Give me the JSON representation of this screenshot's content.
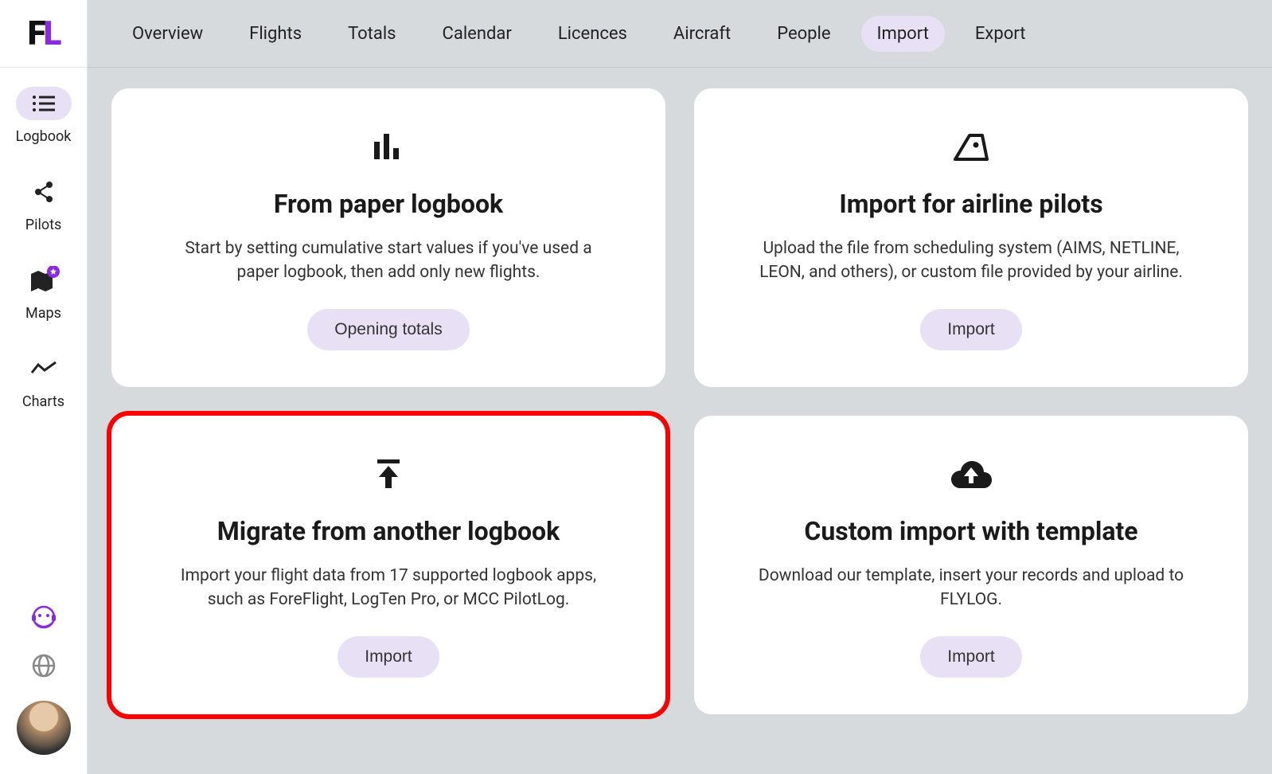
{
  "logo": {
    "f": "F",
    "l": "L"
  },
  "sidebar": {
    "items": [
      {
        "label": "Logbook",
        "active": true
      },
      {
        "label": "Pilots"
      },
      {
        "label": "Maps"
      },
      {
        "label": "Charts"
      }
    ]
  },
  "topnav": {
    "items": [
      {
        "label": "Overview"
      },
      {
        "label": "Flights"
      },
      {
        "label": "Totals"
      },
      {
        "label": "Calendar"
      },
      {
        "label": "Licences"
      },
      {
        "label": "Aircraft"
      },
      {
        "label": "People"
      },
      {
        "label": "Import",
        "active": true
      },
      {
        "label": "Export"
      }
    ]
  },
  "cards": [
    {
      "title": "From paper logbook",
      "desc": "Start by setting cumulative start values if you've used a paper logbook, then add only new flights.",
      "button": "Opening totals"
    },
    {
      "title": "Import for airline pilots",
      "desc": "Upload the file from scheduling system (AIMS, NETLINE, LEON, and others), or custom file provided by your airline.",
      "button": "Import"
    },
    {
      "title": "Migrate from another logbook",
      "desc": "Import your flight data from 17 supported logbook apps, such as ForeFlight, LogTen Pro, or MCC PilotLog.",
      "button": "Import",
      "highlight": true
    },
    {
      "title": "Custom import with template",
      "desc": "Download our template, insert your records and upload to FLYLOG.",
      "button": "Import"
    }
  ]
}
